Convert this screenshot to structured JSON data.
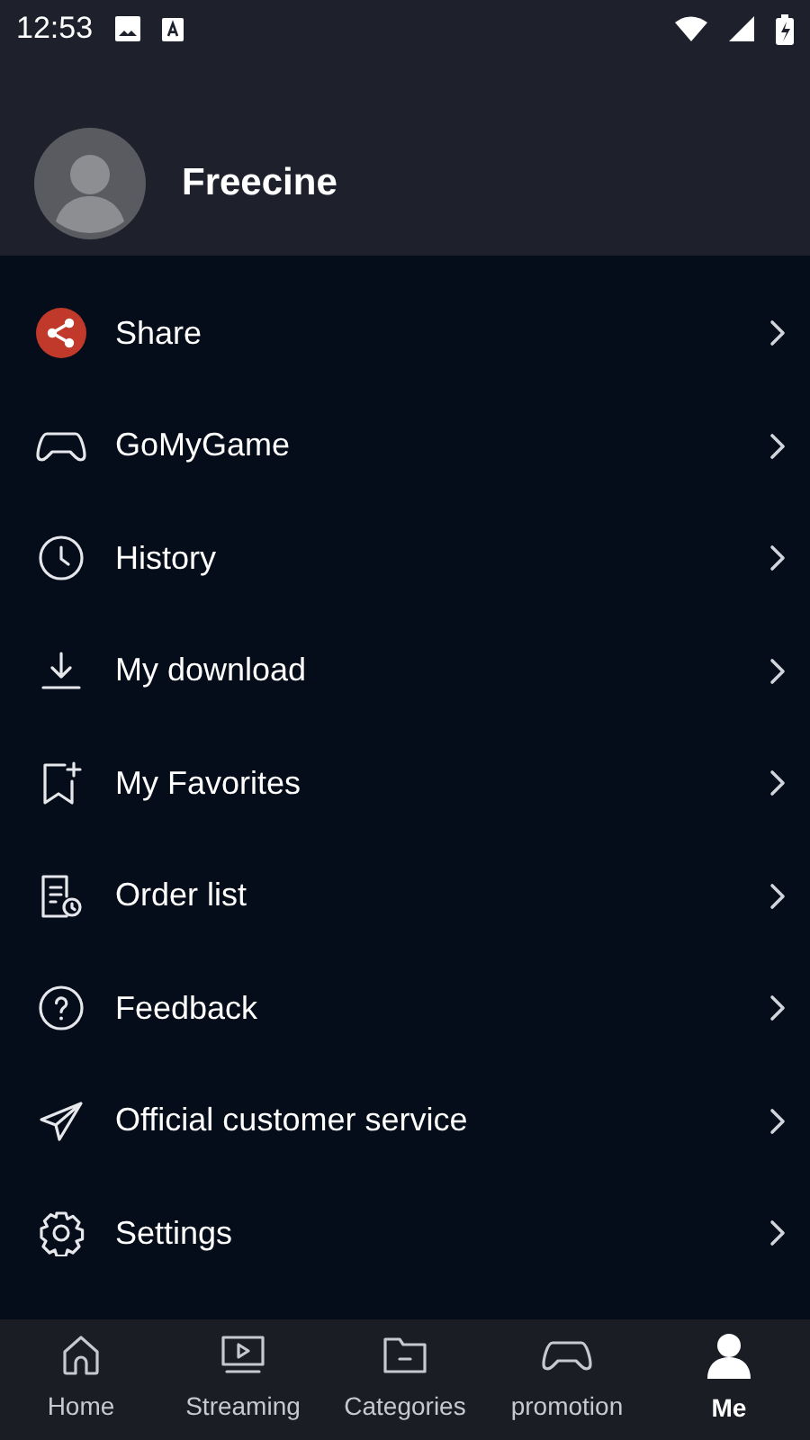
{
  "status_bar": {
    "time": "12:53"
  },
  "profile": {
    "name": "Freecine"
  },
  "menu": [
    {
      "kind": "share",
      "label": "Share"
    },
    {
      "kind": "game",
      "label": "GoMyGame"
    },
    {
      "kind": "history",
      "label": "History"
    },
    {
      "kind": "download",
      "label": "My download"
    },
    {
      "kind": "favorites",
      "label": "My Favorites"
    },
    {
      "kind": "orders",
      "label": "Order list"
    },
    {
      "kind": "feedback",
      "label": "Feedback"
    },
    {
      "kind": "service",
      "label": "Official customer service"
    },
    {
      "kind": "settings",
      "label": "Settings"
    }
  ],
  "bottom_nav": [
    {
      "kind": "home",
      "label": "Home",
      "selected": false
    },
    {
      "kind": "streaming",
      "label": "Streaming",
      "selected": false
    },
    {
      "kind": "categories",
      "label": "Categories",
      "selected": false
    },
    {
      "kind": "game",
      "label": "promotion",
      "selected": false
    },
    {
      "kind": "me",
      "label": "Me",
      "selected": true
    }
  ]
}
